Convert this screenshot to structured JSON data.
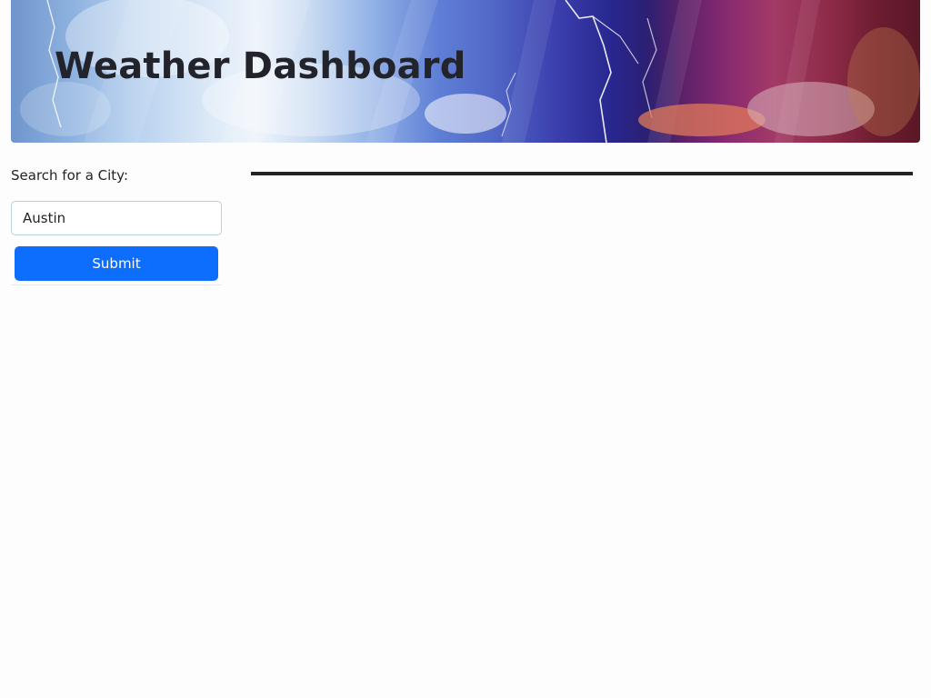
{
  "header": {
    "title": "Weather Dashboard"
  },
  "search": {
    "label": "Search for a City:",
    "value": "Austin",
    "submit_label": "Submit"
  },
  "colors": {
    "primary_button": "#0d6efd",
    "title_text": "#23232b",
    "rule": "#212529"
  }
}
